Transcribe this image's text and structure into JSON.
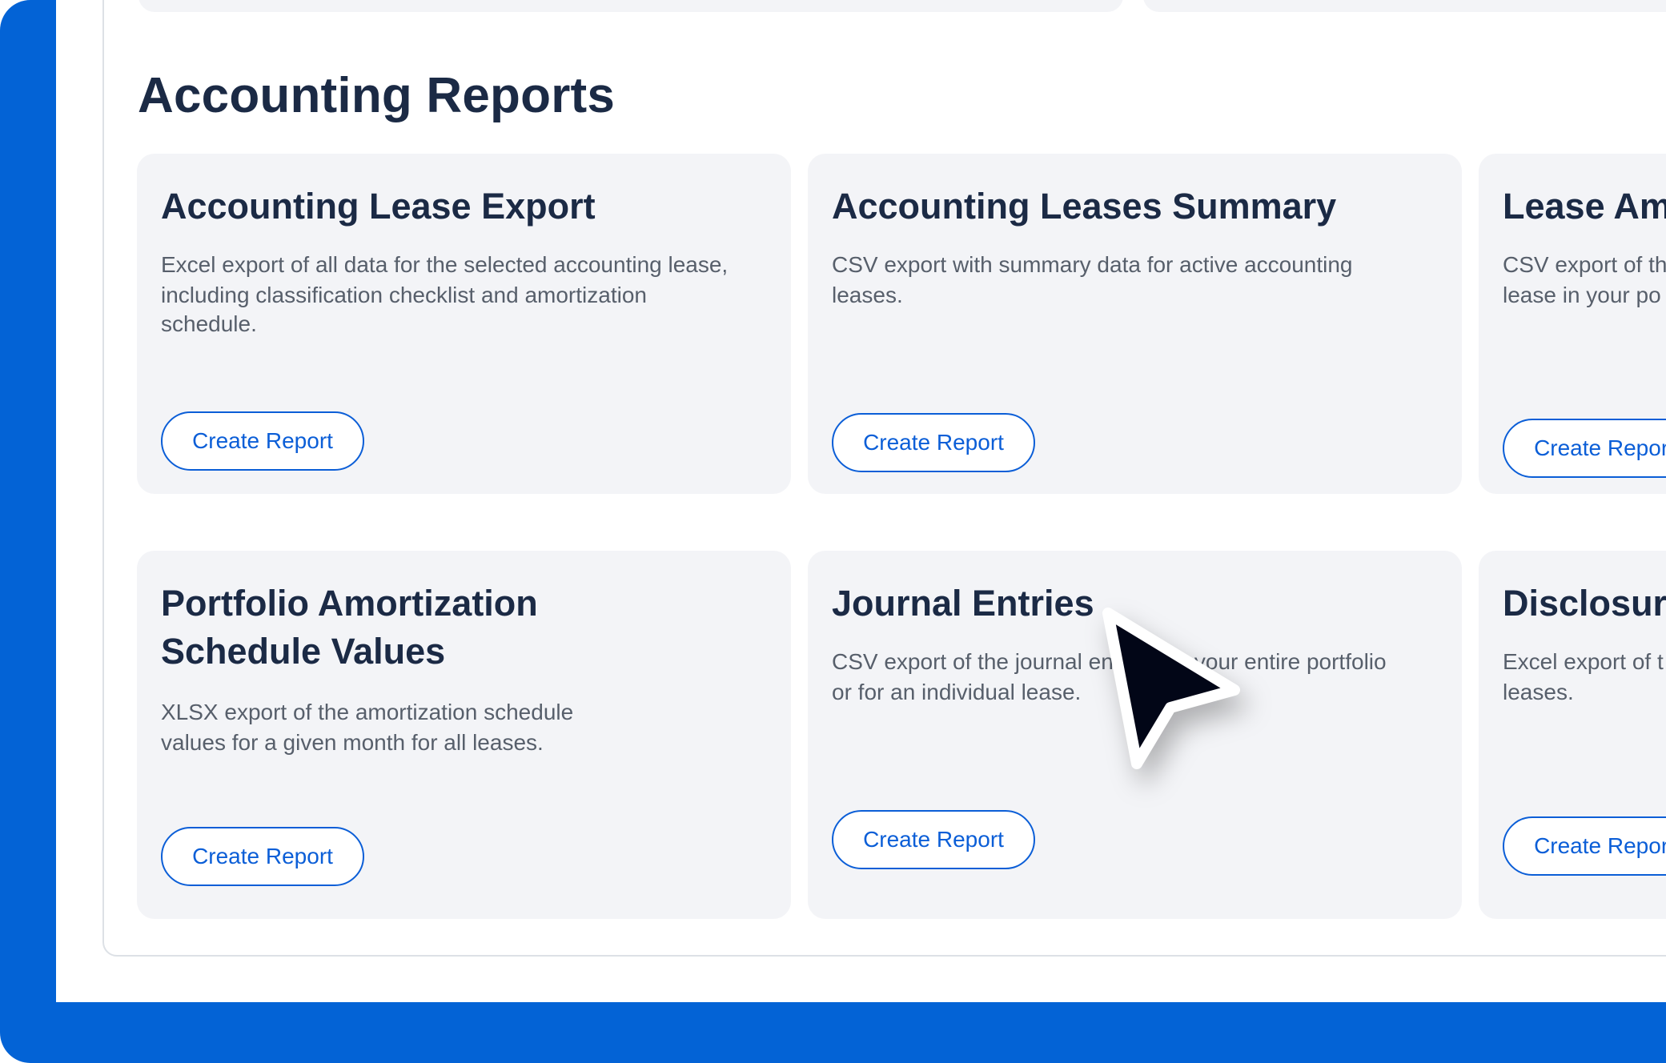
{
  "section": {
    "title": "Accounting Reports"
  },
  "cards": [
    {
      "title_lines": [
        "Accounting Lease Export"
      ],
      "description_lines": [
        "Excel export of all data for the selected accounting lease,",
        "including classification checklist and amortization",
        "schedule."
      ],
      "button_label": "Create Report"
    },
    {
      "title_lines": [
        "Accounting Leases Summary"
      ],
      "description_lines": [
        "CSV export with summary data for active accounting",
        "leases."
      ],
      "button_label": "Create Report"
    },
    {
      "title_lines": [
        "Lease Am"
      ],
      "description_lines": [
        "CSV export of th",
        "lease in your po"
      ],
      "button_label": "Create Report"
    },
    {
      "title_lines": [
        "Portfolio Amortization",
        "Schedule Values"
      ],
      "description_lines": [
        "XLSX export of the amortization schedule",
        "values for a given month for all leases."
      ],
      "button_label": "Create Report"
    },
    {
      "title_lines": [
        "Journal Entries"
      ],
      "description_lines": [
        "CSV export of the journal entries for your entire portfolio",
        "or for an individual lease."
      ],
      "button_label": "Create Report"
    },
    {
      "title_lines": [
        "Disclosure"
      ],
      "description_lines": [
        "Excel export of t",
        "leases."
      ],
      "button_label": "Create Report"
    }
  ],
  "cursor": {
    "icon": "mouse-pointer-icon"
  },
  "colors": {
    "frame_blue": "#0363d6",
    "card_bg": "#f3f4f7",
    "heading": "#1b2a45",
    "body_text": "#575f6b",
    "accent": "#0b5ed7"
  }
}
